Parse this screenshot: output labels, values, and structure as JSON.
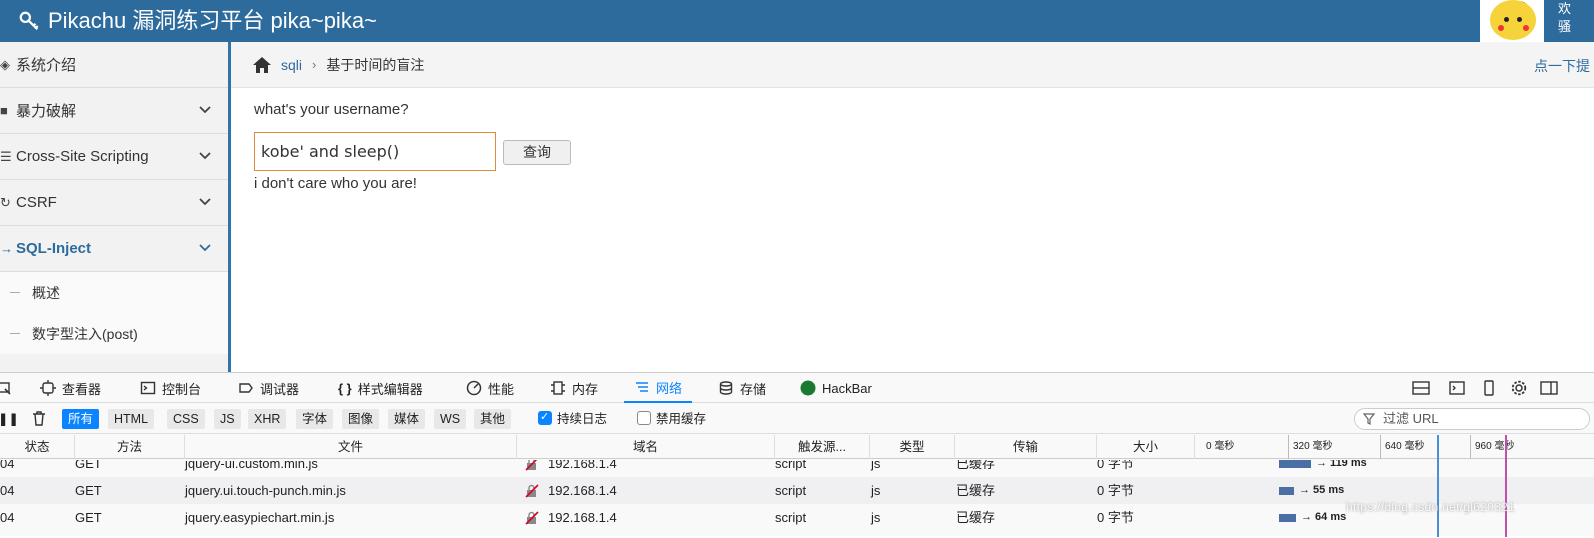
{
  "header": {
    "title": "Pikachu 漏洞练习平台 pika~pika~",
    "user_line1": "欢",
    "user_line2": "骚"
  },
  "sidebar": {
    "items": [
      {
        "label": "系统介绍",
        "icon": "tag-icon"
      },
      {
        "label": "暴力破解",
        "icon": "lock-icon"
      },
      {
        "label": "Cross-Site Scripting",
        "icon": "list-icon"
      },
      {
        "label": "CSRF",
        "icon": "refresh-icon"
      },
      {
        "label": "SQL-Inject",
        "icon": "plug-icon"
      }
    ],
    "sub_items": [
      "概述",
      "数字型注入(post)"
    ]
  },
  "breadcrumb": {
    "link": "sqli",
    "current": "基于时间的盲注",
    "tip": "点一下提"
  },
  "main": {
    "question": "what's your username?",
    "input_value": "kobe' and sleep()",
    "button_label": "查询",
    "result": "i don't care who you are!"
  },
  "devtools": {
    "tabs": [
      "查看器",
      "控制台",
      "调试器",
      "样式编辑器",
      "性能",
      "内存",
      "网络",
      "存储",
      "HackBar"
    ],
    "active_tab": "网络",
    "filters": [
      "所有",
      "HTML",
      "CSS",
      "JS",
      "XHR",
      "字体",
      "图像",
      "媒体",
      "WS",
      "其他"
    ],
    "persist_log": "持续日志",
    "disable_cache": "禁用缓存",
    "url_filter_placeholder": "过滤 URL",
    "columns": [
      "状态",
      "方法",
      "文件",
      "域名",
      "触发源...",
      "类型",
      "传输",
      "大小"
    ],
    "timeline_ticks": [
      "0 毫秒",
      "320 毫秒",
      "640 毫秒",
      "960 毫秒"
    ],
    "rows": [
      {
        "status": "04",
        "method": "GET",
        "file": "jquery-ui.custom.min.js",
        "domain": "192.168.1.4",
        "cause": "script",
        "type": "js",
        "transfer": "已缓存",
        "size": "0 字节",
        "time": "→ 119 ms"
      },
      {
        "status": "04",
        "method": "GET",
        "file": "jquery.ui.touch-punch.min.js",
        "domain": "192.168.1.4",
        "cause": "script",
        "type": "js",
        "transfer": "已缓存",
        "size": "0 字节",
        "time": "→ 55 ms"
      },
      {
        "status": "04",
        "method": "GET",
        "file": "jquery.easypiechart.min.js",
        "domain": "192.168.1.4",
        "cause": "script",
        "type": "js",
        "transfer": "已缓存",
        "size": "0 字节",
        "time": "→ 64 ms"
      }
    ]
  },
  "watermark": "https://blog.csdn.net/gl620321",
  "colors": {
    "header_bg": "#2e6b9d",
    "accent": "#0a84ff",
    "input_border": "#e08a3c"
  }
}
